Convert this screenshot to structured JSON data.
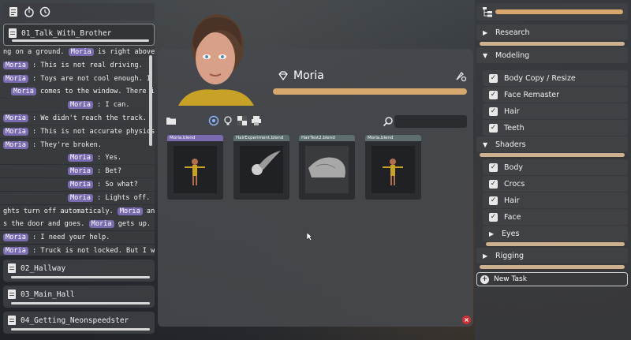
{
  "left": {
    "active_chapter": "01_Talk_With_Brother",
    "chapters": [
      "02_Hallway",
      "03_Main_Hall",
      "04_Getting_Neonspeedster"
    ],
    "script_lines": [
      {
        "indent": 0,
        "parts": [
          {
            "t": "ng on a ground. "
          },
          {
            "n": "Moria"
          },
          {
            "t": " is right above i"
          }
        ]
      },
      {
        "indent": 0,
        "parts": [
          {
            "n": "Moria"
          },
          {
            "t": " : This is not real driving."
          }
        ]
      },
      {
        "indent": 0,
        "parts": [
          {
            "n": "Moria"
          },
          {
            "t": " : Toys are not cool enough. I a"
          }
        ]
      },
      {
        "indent": 10,
        "parts": [
          {
            "n": "Moria"
          },
          {
            "t": " comes to the window. There i"
          }
        ]
      },
      {
        "indent": 82,
        "parts": [
          {
            "n": "Moria"
          },
          {
            "t": " : I can."
          }
        ]
      },
      {
        "indent": 0,
        "parts": [
          {
            "n": "Moria"
          },
          {
            "t": " : We didn't reach the track."
          }
        ]
      },
      {
        "indent": 0,
        "parts": [
          {
            "n": "Moria"
          },
          {
            "t": " : This is not accurate physics"
          }
        ]
      },
      {
        "indent": 0,
        "parts": [
          {
            "n": "Moria"
          },
          {
            "t": " : They're broken."
          }
        ]
      },
      {
        "indent": 82,
        "parts": [
          {
            "n": "Moria"
          },
          {
            "t": " : Yes."
          }
        ]
      },
      {
        "indent": 82,
        "parts": [
          {
            "n": "Moria"
          },
          {
            "t": " : Bet?"
          }
        ]
      },
      {
        "indent": 82,
        "parts": [
          {
            "n": "Moria"
          },
          {
            "t": " : So what?"
          }
        ]
      },
      {
        "indent": 82,
        "parts": [
          {
            "n": "Moria"
          },
          {
            "t": " : Lights off."
          }
        ]
      },
      {
        "indent": 0,
        "parts": [
          {
            "t": "ghts turn off automaticaly. "
          },
          {
            "n": "Moria"
          },
          {
            "t": " and"
          }
        ]
      },
      {
        "indent": 0,
        "parts": [
          {
            "t": "s the door and goes.  "
          },
          {
            "n": "Moria"
          },
          {
            "t": " gets up."
          }
        ]
      },
      {
        "indent": 0,
        "parts": [
          {
            "n": "Moria"
          },
          {
            "t": " : I need your help."
          }
        ]
      },
      {
        "indent": 0,
        "parts": [
          {
            "n": "Moria"
          },
          {
            "t": " : Truck is not locked. But I wou"
          }
        ]
      }
    ]
  },
  "center": {
    "asset_name": "Moria",
    "search": {
      "value": "",
      "placeholder": ""
    },
    "assets": [
      {
        "label": "Moria.blend",
        "active": true,
        "thumb": "character"
      },
      {
        "label": "HairExperiment.blend",
        "active": false,
        "thumb": "hair"
      },
      {
        "label": "HairTest2.blend",
        "active": false,
        "thumb": "mesh"
      },
      {
        "label": "Moria.blend",
        "active": false,
        "thumb": "character"
      }
    ]
  },
  "right": {
    "tasks": [
      {
        "label": "Research",
        "expanded": false,
        "progress": 1.0
      },
      {
        "label": "Modeling",
        "expanded": true,
        "items": [
          "Body Copy / Resize",
          "Face Remaster",
          "Hair",
          "Teeth"
        ]
      },
      {
        "label": "Shaders",
        "expanded": true,
        "progress": 1.0,
        "items": [
          "Body",
          "Crocs",
          "Hair",
          "Face"
        ],
        "sub": {
          "label": "Eyes",
          "progress": 1.0
        }
      },
      {
        "label": "Rigging",
        "expanded": false,
        "progress": 1.0
      }
    ],
    "new_task_label": "New Task"
  },
  "colors": {
    "accent": "#d7a86e",
    "name_tag": "#7a6ab0",
    "close": "#d03030"
  }
}
